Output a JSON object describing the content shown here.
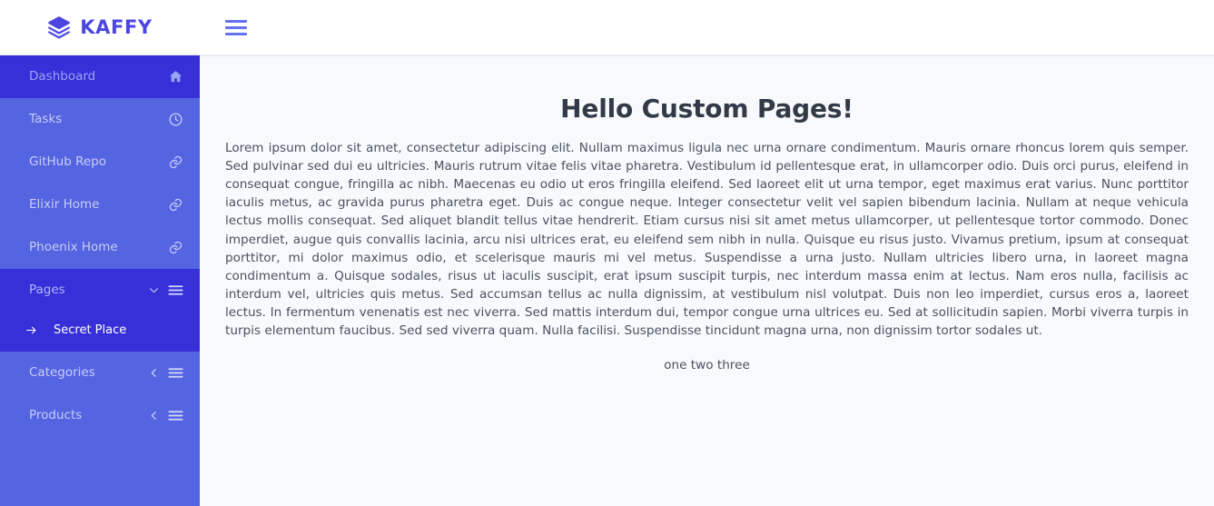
{
  "brand": {
    "name": "KAFFY",
    "logo_icon": "layers-stack-icon",
    "accent_color": "#4c46e0"
  },
  "topbar": {
    "menu_toggle_icon": "hamburger-menu-icon"
  },
  "sidebar": {
    "background_color": "#5564e0",
    "active_background_color": "#3730d8",
    "items": [
      {
        "label": "Dashboard",
        "icon": "home-icon",
        "active": true,
        "type": "link"
      },
      {
        "label": "Tasks",
        "icon": "clock-icon",
        "active": false,
        "type": "link"
      },
      {
        "label": "GitHub Repo",
        "icon": "link-icon",
        "active": false,
        "type": "link"
      },
      {
        "label": "Elixir Home",
        "icon": "link-icon",
        "active": false,
        "type": "link"
      },
      {
        "label": "Phoenix Home",
        "icon": "link-icon",
        "active": false,
        "type": "link"
      }
    ],
    "groups": [
      {
        "label": "Pages",
        "expanded": true,
        "chevron_icon": "chevron-down-icon",
        "list_icon": "list-icon",
        "children": [
          {
            "label": "Secret Place",
            "icon": "arrow-right-icon"
          }
        ]
      },
      {
        "label": "Categories",
        "expanded": false,
        "chevron_icon": "chevron-left-icon",
        "list_icon": "list-icon",
        "children": []
      },
      {
        "label": "Products",
        "expanded": false,
        "chevron_icon": "chevron-left-icon",
        "list_icon": "list-icon",
        "children": []
      }
    ]
  },
  "main": {
    "background_color": "#f8f9fc",
    "title": "Hello Custom Pages!",
    "paragraph": "Lorem ipsum dolor sit amet, consectetur adipiscing elit. Nullam maximus ligula nec urna ornare condimentum. Mauris ornare rhoncus lorem quis semper. Sed pulvinar sed dui eu ultricies. Mauris rutrum vitae felis vitae pharetra. Vestibulum id pellentesque erat, in ullamcorper odio. Duis orci purus, eleifend in consequat congue, fringilla ac nibh. Maecenas eu odio ut eros fringilla eleifend. Sed laoreet elit ut urna tempor, eget maximus erat varius. Nunc porttitor iaculis metus, ac gravida purus pharetra eget. Duis ac congue neque. Integer consectetur velit vel sapien bibendum lacinia. Nullam at neque vehicula lectus mollis consequat. Sed aliquet blandit tellus vitae hendrerit. Etiam cursus nisi sit amet metus ullamcorper, ut pellentesque tortor commodo. Donec imperdiet, augue quis convallis lacinia, arcu nisi ultrices erat, eu eleifend sem nibh in nulla. Quisque eu risus justo. Vivamus pretium, ipsum at consequat porttitor, mi dolor maximus odio, et scelerisque mauris mi vel metus. Suspendisse a urna justo. Nullam ultricies libero urna, in laoreet magna condimentum a. Quisque sodales, risus ut iaculis suscipit, erat ipsum suscipit turpis, nec interdum massa enim at lectus. Nam eros nulla, facilisis ac interdum vel, ultricies quis metus. Sed accumsan tellus ac nulla dignissim, at vestibulum nisl volutpat. Duis non leo imperdiet, cursus eros a, laoreet lectus. In fermentum venenatis est nec viverra. Sed mattis interdum dui, tempor congue urna ultrices eu. Sed at sollicitudin sapien. Morbi viverra turpis in turpis elementum faucibus. Sed sed viverra quam. Nulla facilisi. Suspendisse tincidunt magna urna, non dignissim tortor sodales ut.",
    "footer_line": "one two three"
  }
}
